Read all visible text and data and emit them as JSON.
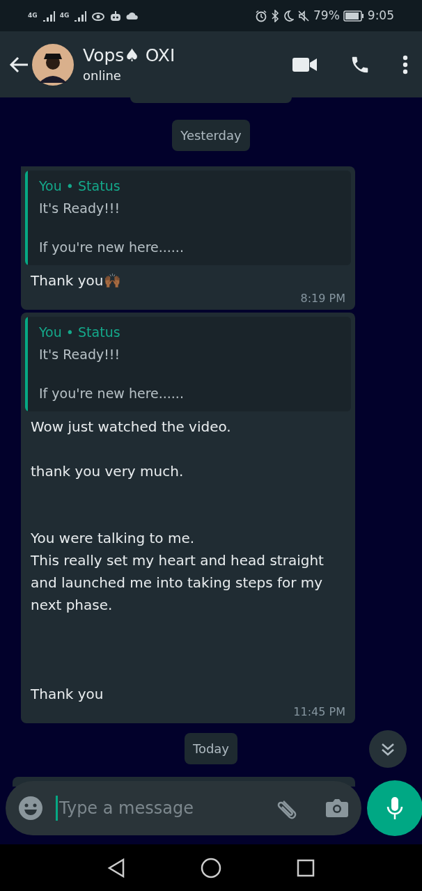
{
  "status_bar": {
    "network_1": "4G",
    "network_2": "4G",
    "battery": "79%",
    "time": "9:05"
  },
  "header": {
    "contact_name": "Vops♠ OXI",
    "presence": "online"
  },
  "chat": {
    "date_dividers": [
      "Yesterday",
      "Today"
    ],
    "messages": [
      {
        "quote": {
          "sender": "You • Status",
          "lines": [
            "It's Ready!!!",
            "If you're new here......"
          ]
        },
        "text": "Thank you🙌🏾",
        "time": "8:19 PM"
      },
      {
        "quote": {
          "sender": "You • Status",
          "lines": [
            "It's Ready!!!",
            "If you're new here......"
          ]
        },
        "text": "Wow just watched the video.\n\nthank you very much.\n\n\nYou were talking to me.\nThis really set my heart and head straight and launched me into taking steps for my next phase.\n\n\n\nThank you",
        "time": "11:45 PM"
      }
    ]
  },
  "composer": {
    "placeholder": "Type a message"
  }
}
